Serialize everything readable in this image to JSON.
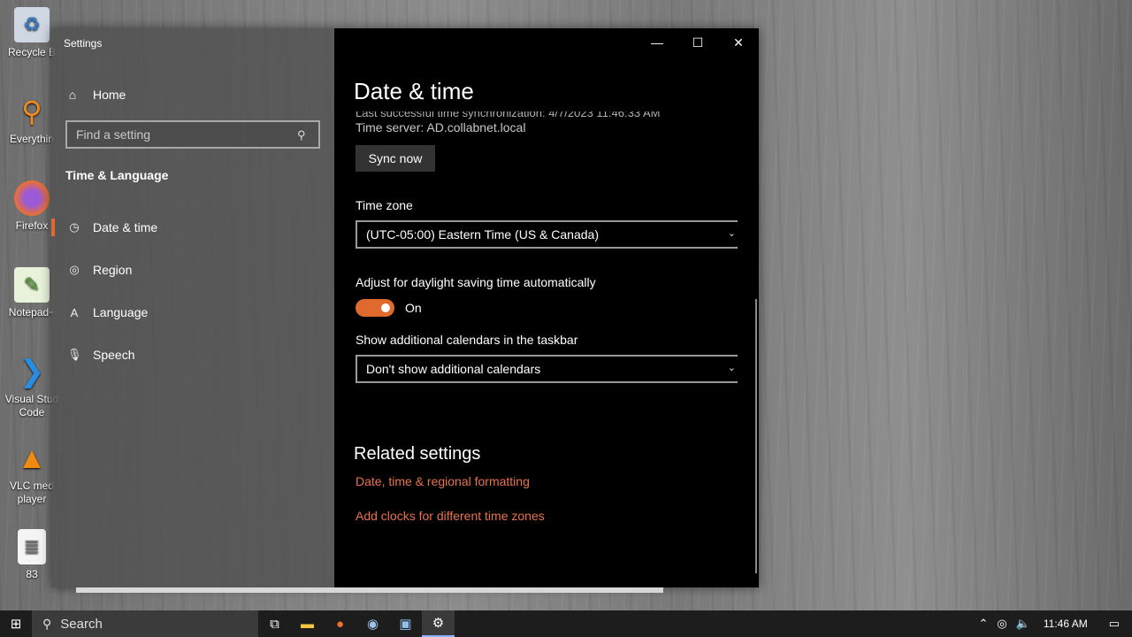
{
  "desktop": {
    "icons": [
      {
        "label": "Recycle B",
        "icon": "recycle-bin-icon"
      },
      {
        "label": "Everythin",
        "icon": "everything-search-icon"
      },
      {
        "label": "Firefox",
        "icon": "firefox-icon"
      },
      {
        "label": "Notepad+",
        "icon": "notepadpp-icon"
      },
      {
        "label": "Visual Stud",
        "label2": "Code",
        "icon": "vscode-icon"
      },
      {
        "label": "VLC med",
        "label2": "player",
        "icon": "vlc-icon"
      },
      {
        "label": "83",
        "icon": "document-icon"
      }
    ]
  },
  "window": {
    "title": "Settings",
    "controls": {
      "minimize": "—",
      "maximize": "☐",
      "close": "✕"
    }
  },
  "sidebar": {
    "home_label": "Home",
    "search_placeholder": "Find a setting",
    "section": "Time & Language",
    "items": [
      {
        "label": "Date & time",
        "icon": "clock-calendar-icon",
        "active": true
      },
      {
        "label": "Region",
        "icon": "globe-icon",
        "active": false
      },
      {
        "label": "Language",
        "icon": "language-icon",
        "active": false
      },
      {
        "label": "Speech",
        "icon": "microphone-icon",
        "active": false
      }
    ]
  },
  "main": {
    "page_title": "Date & time",
    "last_sync_partial": "Last successful time synchronization: 4/7/2023 11:46:33 AM",
    "time_server": "Time server: AD.collabnet.local",
    "sync_button": "Sync now",
    "time_zone_label": "Time zone",
    "time_zone_value": "(UTC-05:00) Eastern Time (US & Canada)",
    "dst_label": "Adjust for daylight saving time automatically",
    "dst_state": "On",
    "calendars_label": "Show additional calendars in the taskbar",
    "calendars_value": "Don't show additional calendars",
    "related_title": "Related settings",
    "links": [
      "Date, time & regional formatting",
      "Add clocks for different time zones"
    ]
  },
  "taskbar": {
    "search_label": "Search",
    "clock": "11:46 AM"
  },
  "colors": {
    "accent": "#e06a2e",
    "link": "#e8734a"
  }
}
